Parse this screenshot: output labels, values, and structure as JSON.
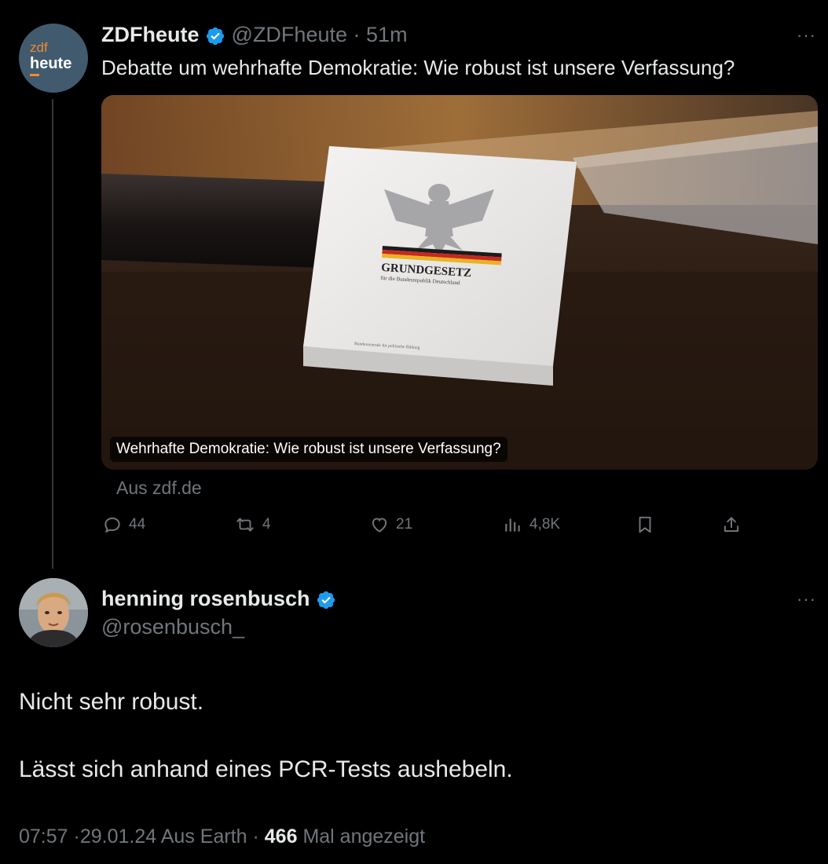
{
  "quoted_tweet": {
    "avatar_small": "zdf",
    "avatar_big": "heute",
    "name": "ZDFheute",
    "handle": "@ZDFheute",
    "separator": "·",
    "time": "51m",
    "more": "···",
    "text": "Debatte um wehrhafte Demokratie: Wie robust ist unsere Verfassung?",
    "card": {
      "book_title": "GRUNDGESETZ",
      "book_subtitle": "für die Bundesrepublik Deutschland",
      "book_publisher": "Bundeszentrale für politische Bildung",
      "caption": "Wehrhafte Demokratie: Wie robust ist unsere Verfassung?",
      "source": "Aus zdf.de"
    },
    "actions": {
      "replies": "44",
      "retweets": "4",
      "likes": "21",
      "views": "4,8K"
    }
  },
  "reply_tweet": {
    "name": "henning rosenbusch",
    "handle": "@rosenbusch_",
    "more": "···",
    "line1": "Nicht sehr robust.",
    "line2": "Lässt sich anhand eines PCR-Tests aushebeln.",
    "meta": {
      "time": "07:57",
      "sep1": "·",
      "date": "29.01.24",
      "location": "Aus Earth",
      "sep2": "·",
      "views": "466",
      "views_label": "Mal angezeigt"
    }
  },
  "icons": [
    "verified-badge-icon",
    "reply-icon",
    "retweet-icon",
    "like-icon",
    "views-icon",
    "bookmark-icon",
    "share-icon",
    "more-icon"
  ],
  "colors": {
    "background": "#000000",
    "text": "#e7e9ea",
    "muted": "#71767b",
    "verified": "#1d9bf0",
    "zdf_orange": "#f08a32"
  }
}
